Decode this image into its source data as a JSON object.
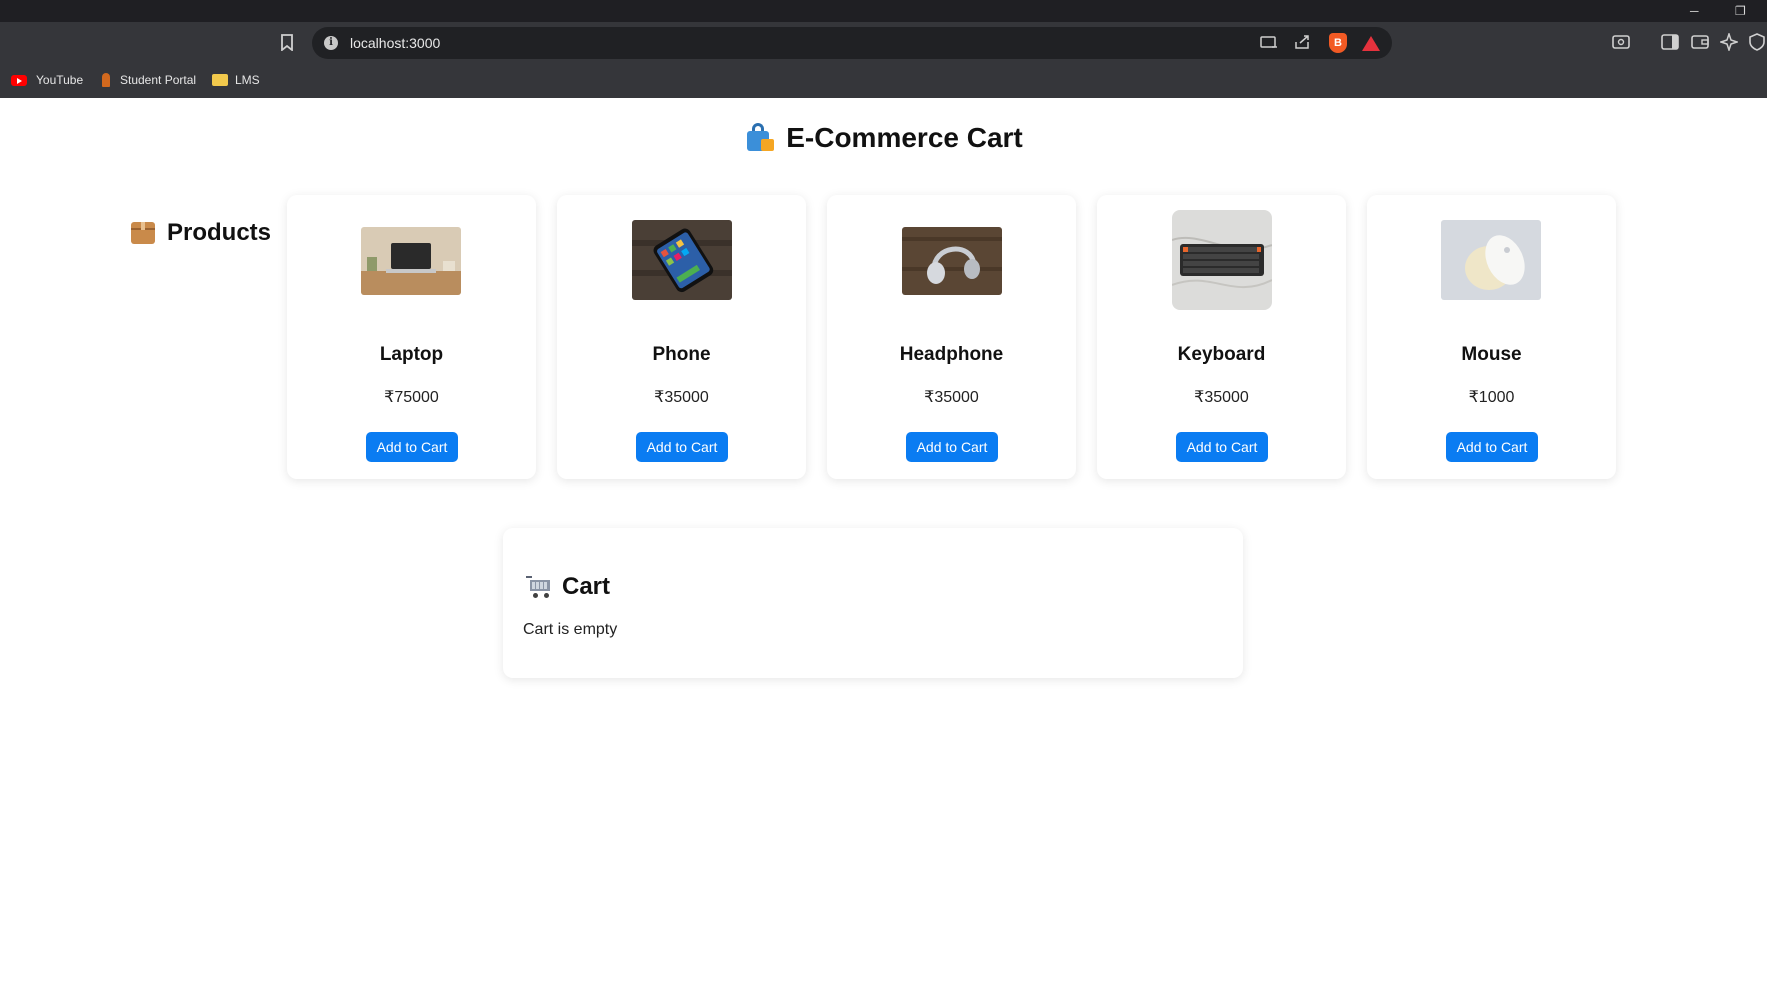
{
  "browser": {
    "url": "localhost:3000",
    "bookmarks": [
      {
        "label": "YouTube",
        "icon": "youtube-icon"
      },
      {
        "label": "Student Portal",
        "icon": "student-portal-icon"
      },
      {
        "label": "LMS",
        "icon": "folder-icon"
      }
    ]
  },
  "page": {
    "title": "E-Commerce Cart",
    "title_icon": "shopping-bags-icon",
    "products_heading": "Products",
    "products_icon": "package-icon"
  },
  "products": [
    {
      "name": "Laptop",
      "price": "₹75000",
      "button": "Add to Cart",
      "image": "laptop-photo"
    },
    {
      "name": "Phone",
      "price": "₹35000",
      "button": "Add to Cart",
      "image": "phone-photo"
    },
    {
      "name": "Headphone",
      "price": "₹35000",
      "button": "Add to Cart",
      "image": "headphone-photo"
    },
    {
      "name": "Keyboard",
      "price": "₹35000",
      "button": "Add to Cart",
      "image": "keyboard-photo"
    },
    {
      "name": "Mouse",
      "price": "₹1000",
      "button": "Add to Cart",
      "image": "mouse-photo"
    }
  ],
  "cart": {
    "heading": "Cart",
    "icon": "shopping-cart-icon",
    "empty_text": "Cart is empty"
  },
  "colors": {
    "button": "#0a7cf2",
    "chrome": "#35363a",
    "omnibox": "#202124"
  }
}
